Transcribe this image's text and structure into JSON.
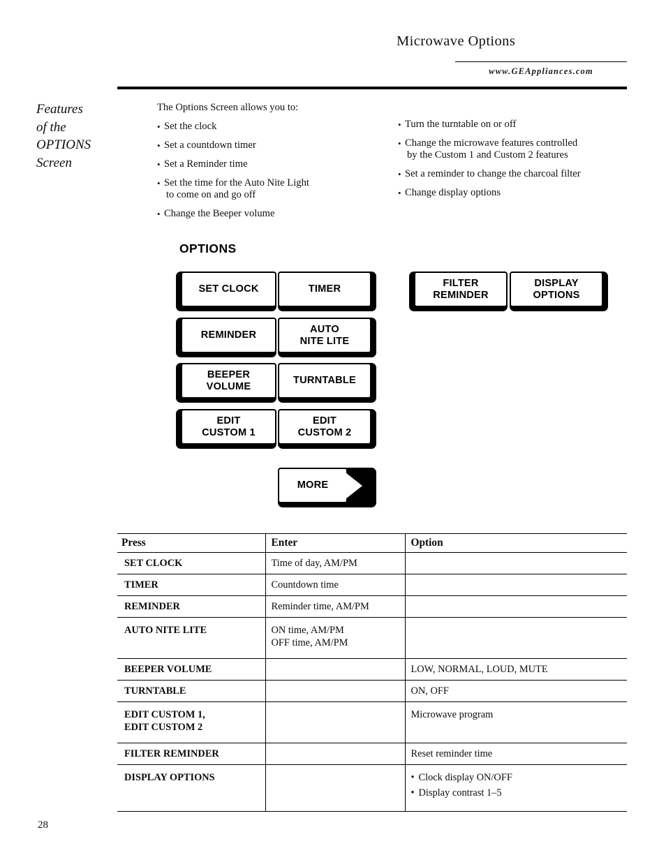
{
  "header": {
    "title": "Microwave Options",
    "url": "www.GEAppliances.com"
  },
  "section_heading": {
    "line1": "Features",
    "line2": "of the",
    "line3": "OPTIONS",
    "line4": "Screen"
  },
  "intro": {
    "lead": "The Options Screen allows you to:",
    "left_bullets": [
      {
        "text": "Set the clock",
        "cont": ""
      },
      {
        "text": "Set a countdown timer",
        "cont": ""
      },
      {
        "text": "Set a Reminder time",
        "cont": ""
      },
      {
        "text": "Set the time for the Auto Nite Light",
        "cont": "to come on and go off"
      },
      {
        "text": "Change the Beeper volume",
        "cont": ""
      }
    ],
    "right_bullets": [
      {
        "text": "Turn the turntable on or off",
        "cont": ""
      },
      {
        "text": "Change the microwave features controlled",
        "cont": "by the Custom 1 and Custom 2 features"
      },
      {
        "text": "Set a reminder to change the charcoal filter",
        "cont": ""
      },
      {
        "text": "Change display options",
        "cont": ""
      }
    ]
  },
  "options_panel": {
    "label": "OPTIONS",
    "buttons": {
      "set_clock": "SET CLOCK",
      "timer": "TIMER",
      "reminder": "REMINDER",
      "auto_nite_lite_l1": "AUTO",
      "auto_nite_lite_l2": "NITE LITE",
      "beeper_volume_l1": "BEEPER",
      "beeper_volume_l2": "VOLUME",
      "turntable": "TURNTABLE",
      "edit_custom_1_l1": "EDIT",
      "edit_custom_1_l2": "CUSTOM 1",
      "edit_custom_2_l1": "EDIT",
      "edit_custom_2_l2": "CUSTOM 2",
      "filter_reminder_l1": "FILTER",
      "filter_reminder_l2": "REMINDER",
      "display_options_l1": "DISPLAY",
      "display_options_l2": "OPTIONS",
      "more": "MORE"
    }
  },
  "ref_table": {
    "headers": {
      "press": "Press",
      "enter": "Enter",
      "option": "Option"
    },
    "rows": [
      {
        "press": "SET CLOCK",
        "press2": "",
        "enter": "Time of day, AM/PM",
        "enter2": "",
        "option": "",
        "option2": ""
      },
      {
        "press": "TIMER",
        "press2": "",
        "enter": "Countdown time",
        "enter2": "",
        "option": "",
        "option2": ""
      },
      {
        "press": "REMINDER",
        "press2": "",
        "enter": "Reminder time, AM/PM",
        "enter2": "",
        "option": "",
        "option2": ""
      },
      {
        "press": "AUTO NITE LITE",
        "press2": "",
        "enter": "ON time, AM/PM",
        "enter2": "OFF time, AM/PM",
        "option": "",
        "option2": ""
      },
      {
        "press": "BEEPER VOLUME",
        "press2": "",
        "enter": "",
        "enter2": "",
        "option": "LOW, NORMAL, LOUD, MUTE",
        "option2": ""
      },
      {
        "press": "TURNTABLE",
        "press2": "",
        "enter": "",
        "enter2": "",
        "option": "ON, OFF",
        "option2": ""
      },
      {
        "press": "EDIT CUSTOM 1,",
        "press2": "EDIT CUSTOM 2",
        "enter": "",
        "enter2": "",
        "option": "Microwave program",
        "option2": ""
      },
      {
        "press": "FILTER REMINDER",
        "press2": "",
        "enter": "",
        "enter2": "",
        "option": "Reset reminder time",
        "option2": ""
      },
      {
        "press": "DISPLAY OPTIONS",
        "press2": "",
        "enter": "",
        "enter2": "",
        "option": "Clock display ON/OFF",
        "option2": "Display contrast 1–5"
      }
    ]
  },
  "footer": {
    "page_number": "28"
  }
}
